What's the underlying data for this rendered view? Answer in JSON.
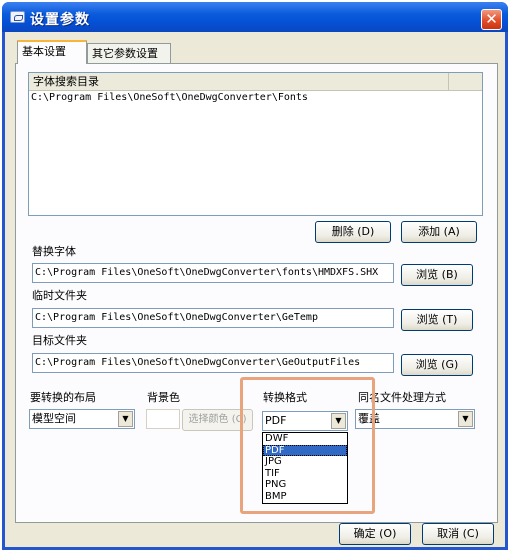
{
  "window": {
    "title": "设置参数",
    "close_glyph": "✕"
  },
  "tabs": [
    {
      "label": "基本设置"
    },
    {
      "label": "其它参数设置"
    }
  ],
  "font_dirs": {
    "header": "字体搜索目录",
    "rows": [
      "C:\\Program Files\\OneSoft\\OneDwgConverter\\Fonts"
    ]
  },
  "buttons": {
    "delete": "删除 (D)",
    "add": "添加 (A)",
    "browse_replace": "浏览 (B)",
    "browse_temp": "浏览 (T)",
    "browse_target": "浏览 (G)",
    "choose_color": "选择颜色 (C)",
    "ok": "确定 (O)",
    "cancel": "取消 (C)"
  },
  "replace_font": {
    "label": "替换字体",
    "value": "C:\\Program Files\\OneSoft\\OneDwgConverter\\fonts\\HMDXFS.SHX"
  },
  "temp_folder": {
    "label": "临时文件夹",
    "value": "C:\\Program Files\\OneSoft\\OneDwgConverter\\GeTemp"
  },
  "target_folder": {
    "label": "目标文件夹",
    "value": "C:\\Program Files\\OneSoft\\OneDwgConverter\\GeOutputFiles"
  },
  "layout": {
    "label": "要转换的布局",
    "value": "模型空间"
  },
  "background": {
    "label": "背景色"
  },
  "format": {
    "label": "转换格式",
    "value": "PDF",
    "options": [
      "DWF",
      "PDF",
      "JPG",
      "TIF",
      "PNG",
      "BMP"
    ],
    "selected": "PDF"
  },
  "same_name": {
    "label": "同名文件处理方式",
    "value": "覆盖"
  },
  "colors": {
    "titlebar": "#0a5bdc",
    "face": "#ece9d8",
    "selection": "#316ac5",
    "highlight_box": "#e8a47c"
  }
}
